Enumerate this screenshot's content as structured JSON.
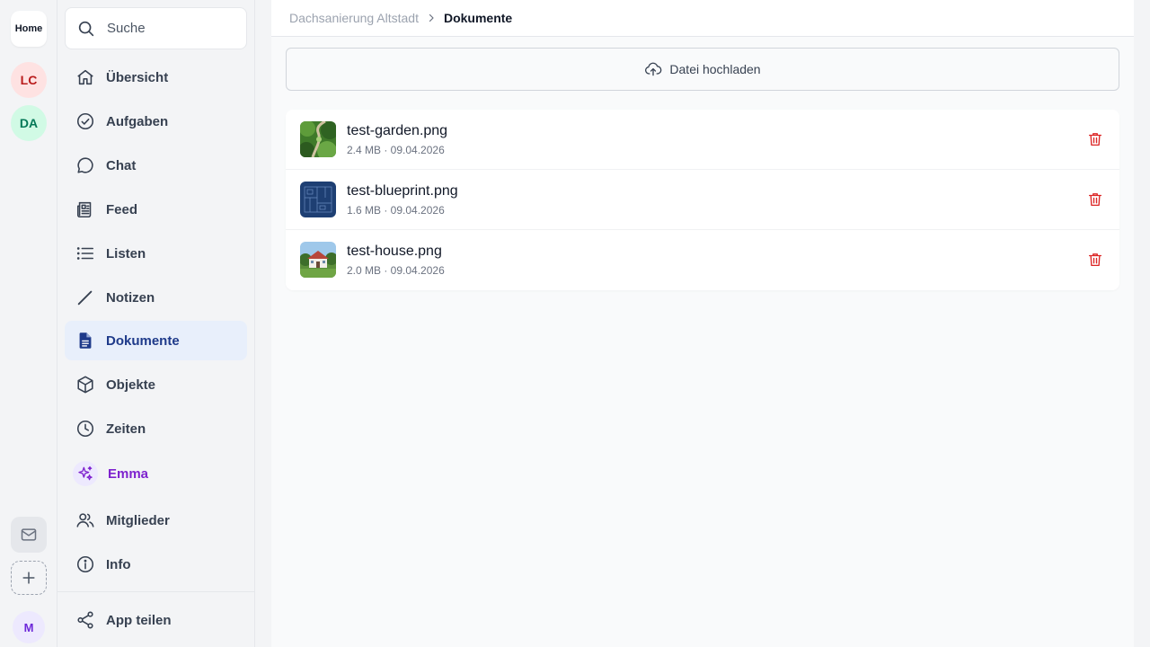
{
  "rail": {
    "home_label": "Home",
    "workspaces": [
      {
        "initials": "LC",
        "bg": "#fee2e2",
        "color": "#b91c1c"
      },
      {
        "initials": "DA",
        "bg": "#d1fae5",
        "color": "#047857"
      }
    ],
    "mail_icon": "mail-icon",
    "add_icon": "plus-icon",
    "user_initial": "M"
  },
  "sidebar": {
    "search_placeholder": "Suche",
    "items": [
      {
        "label": "Übersicht",
        "icon": "home-icon"
      },
      {
        "label": "Aufgaben",
        "icon": "check-circle-icon"
      },
      {
        "label": "Chat",
        "icon": "chat-bubble-icon"
      },
      {
        "label": "Feed",
        "icon": "newspaper-icon"
      },
      {
        "label": "Listen",
        "icon": "list-icon"
      },
      {
        "label": "Notizen",
        "icon": "pencil-icon"
      },
      {
        "label": "Dokumente",
        "icon": "document-icon",
        "active": true
      },
      {
        "label": "Objekte",
        "icon": "cube-icon"
      },
      {
        "label": "Zeiten",
        "icon": "clock-icon"
      },
      {
        "label": "Emma",
        "icon": "sparkles-icon"
      },
      {
        "label": "Mitglieder",
        "icon": "users-icon"
      },
      {
        "label": "Info",
        "icon": "info-icon"
      }
    ],
    "share_label": "App teilen"
  },
  "breadcrumb": {
    "parent": "Dachsanierung Altstadt",
    "current": "Dokumente"
  },
  "upload_label": "Datei hochladen",
  "files": [
    {
      "name": "test-garden.png",
      "size": "2.4 MB",
      "date": "09.04.2026",
      "meta": "2.4 MB · 09.04.2026"
    },
    {
      "name": "test-blueprint.png",
      "size": "1.6 MB",
      "date": "09.04.2026",
      "meta": "1.6 MB · 09.04.2026"
    },
    {
      "name": "test-house.png",
      "size": "2.0 MB",
      "date": "09.04.2026",
      "meta": "2.0 MB · 09.04.2026"
    }
  ],
  "colors": {
    "accent": "#1e3a8a",
    "active_bg": "#e8effb",
    "delete": "#dc2626",
    "emma": "#7e22ce"
  }
}
